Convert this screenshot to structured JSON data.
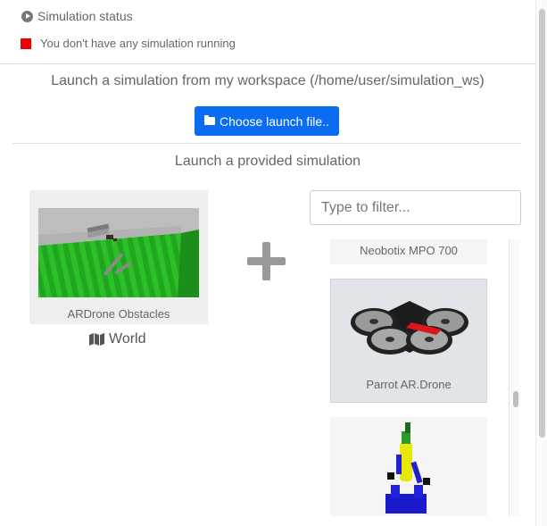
{
  "status": {
    "header": "Simulation status",
    "message": "You don't have any simulation running",
    "indicator_color": "#e00000"
  },
  "workspace": {
    "title": "Launch a simulation from my workspace (/home/user/simulation_ws)",
    "button_label": "Choose launch file..",
    "button_icon": "folder-icon",
    "accent": "#0a6cf0"
  },
  "provided": {
    "title": "Launch a provided simulation",
    "world": {
      "name": "ARDrone Obstacles",
      "type_label": "World",
      "type_icon": "map-icon"
    },
    "filter": {
      "placeholder": "Type to filter...",
      "value": ""
    },
    "robots": [
      {
        "name": "Neobotix MPO 700",
        "selected": false
      },
      {
        "name": "Parrot AR.Drone",
        "selected": true
      },
      {
        "name": "",
        "selected": false
      }
    ]
  }
}
